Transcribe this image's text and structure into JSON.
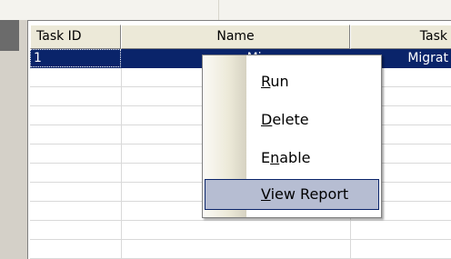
{
  "grid": {
    "columns": [
      {
        "label": "Task ID"
      },
      {
        "label": "Name"
      },
      {
        "label": "Task"
      }
    ],
    "rows": [
      {
        "task_id": "1",
        "name": "Mig",
        "task": "Migrat",
        "selected": true
      }
    ]
  },
  "context_menu": {
    "items": [
      {
        "pre": "",
        "accel": "R",
        "post": "un",
        "highlighted": false
      },
      {
        "pre": "",
        "accel": "D",
        "post": "elete",
        "highlighted": false
      },
      {
        "pre": "E",
        "accel": "n",
        "post": "able",
        "highlighted": false
      },
      {
        "pre": "",
        "accel": "V",
        "post": "iew Report",
        "highlighted": true
      }
    ]
  },
  "colors": {
    "selection": "#0a246a",
    "menu_highlight": "#b6bdd2",
    "header_bg": "#ece9d8"
  }
}
